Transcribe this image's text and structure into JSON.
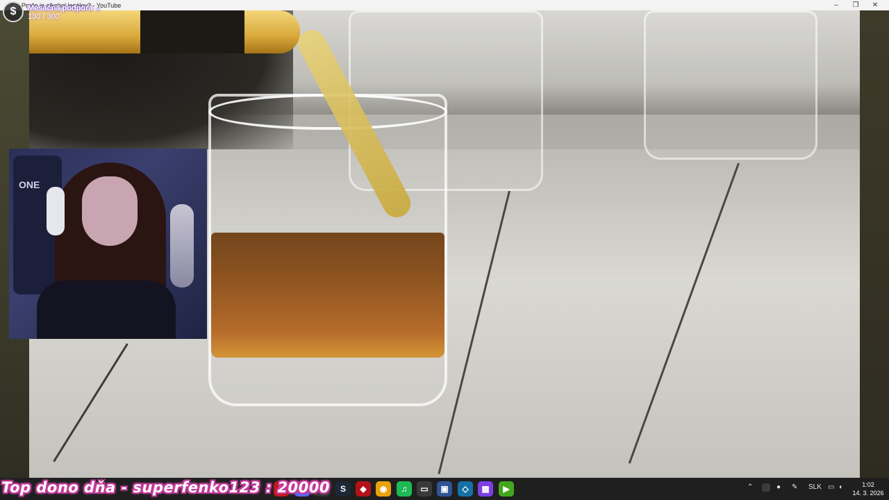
{
  "window": {
    "title": "[...] Prečo je alkohol legálny? - YouTube",
    "minimize": "–",
    "maximize": "❐",
    "close": "✕"
  },
  "support_widget": {
    "icon": "dollar-coin-icon",
    "label": "Mesačná podpora ⌄",
    "count": "130 / 300"
  },
  "webcam": {
    "chair_text": "ONE"
  },
  "donor_banner": {
    "text": "Top dono dňa - superfenko123 : 20000"
  },
  "taskbar": {
    "apps": [
      {
        "name": "opera-icon",
        "glyph": "O",
        "color": "#c4161c"
      },
      {
        "name": "discord-icon",
        "glyph": "D",
        "color": "#5865f2"
      },
      {
        "name": "obs-icon",
        "glyph": "●",
        "color": "#333333"
      },
      {
        "name": "steam-icon",
        "glyph": "S",
        "color": "#1b2838"
      },
      {
        "name": "app-red-icon",
        "glyph": "◆",
        "color": "#b3121b"
      },
      {
        "name": "chrome-icon",
        "glyph": "◉",
        "color": "#e8a20a"
      },
      {
        "name": "spotify-icon",
        "glyph": "♫",
        "color": "#1db954"
      },
      {
        "name": "terminal-icon",
        "glyph": "▭",
        "color": "#3a3a3a"
      },
      {
        "name": "window-app-icon",
        "glyph": "▣",
        "color": "#2f5597"
      },
      {
        "name": "diamond-app-icon",
        "glyph": "◇",
        "color": "#1570a6"
      },
      {
        "name": "grid-app-icon",
        "glyph": "▦",
        "color": "#7b3fe4"
      },
      {
        "name": "play-app-icon",
        "glyph": "▶",
        "color": "#44a61d"
      }
    ],
    "tray": {
      "chevron": "⌃",
      "language": "SLK",
      "time": "1:02",
      "date": "14. 3. 2026"
    }
  }
}
